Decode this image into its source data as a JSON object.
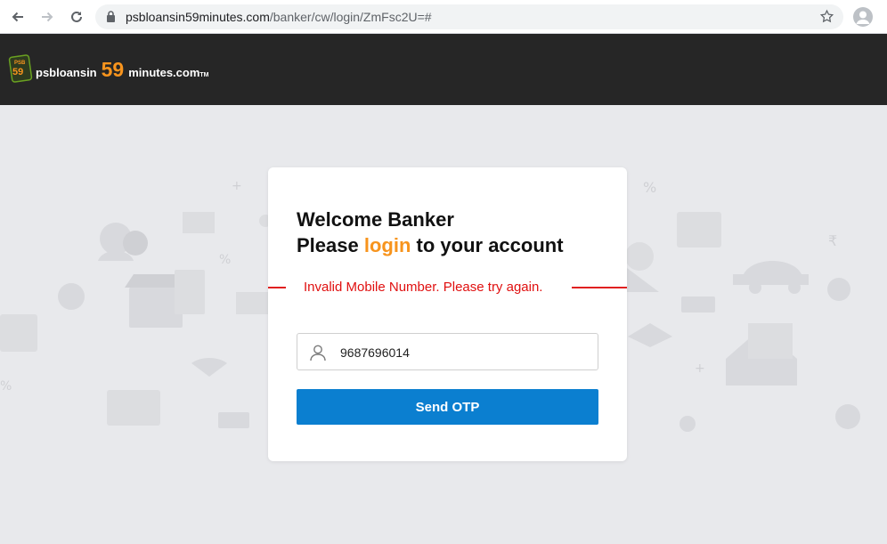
{
  "browser": {
    "url_host": "psbloansin59minutes.com",
    "url_path": "/banker/cw/login/ZmFsc2U=#",
    "icons": [
      "back-icon",
      "forward-icon",
      "reload-icon",
      "lock-icon",
      "star-icon",
      "profile-icon"
    ]
  },
  "header": {
    "logo_badge_top": "PSB",
    "logo_badge_num": "59",
    "logo_prefix": "psbloansin",
    "logo_num": "59",
    "logo_suffix": "minutes.com",
    "logo_tm": "TM"
  },
  "login": {
    "welcome_line": "Welcome Banker",
    "please": "Please",
    "login_word": "login",
    "rest": "to your account",
    "error": "Invalid Mobile Number. Please try again.",
    "mobile_value": "9687696014",
    "send_otp_label": "Send OTP"
  },
  "colors": {
    "accent_orange": "#f7941d",
    "button_blue": "#0b7fd0",
    "error_red": "#e01010",
    "header_bg": "#262626"
  }
}
